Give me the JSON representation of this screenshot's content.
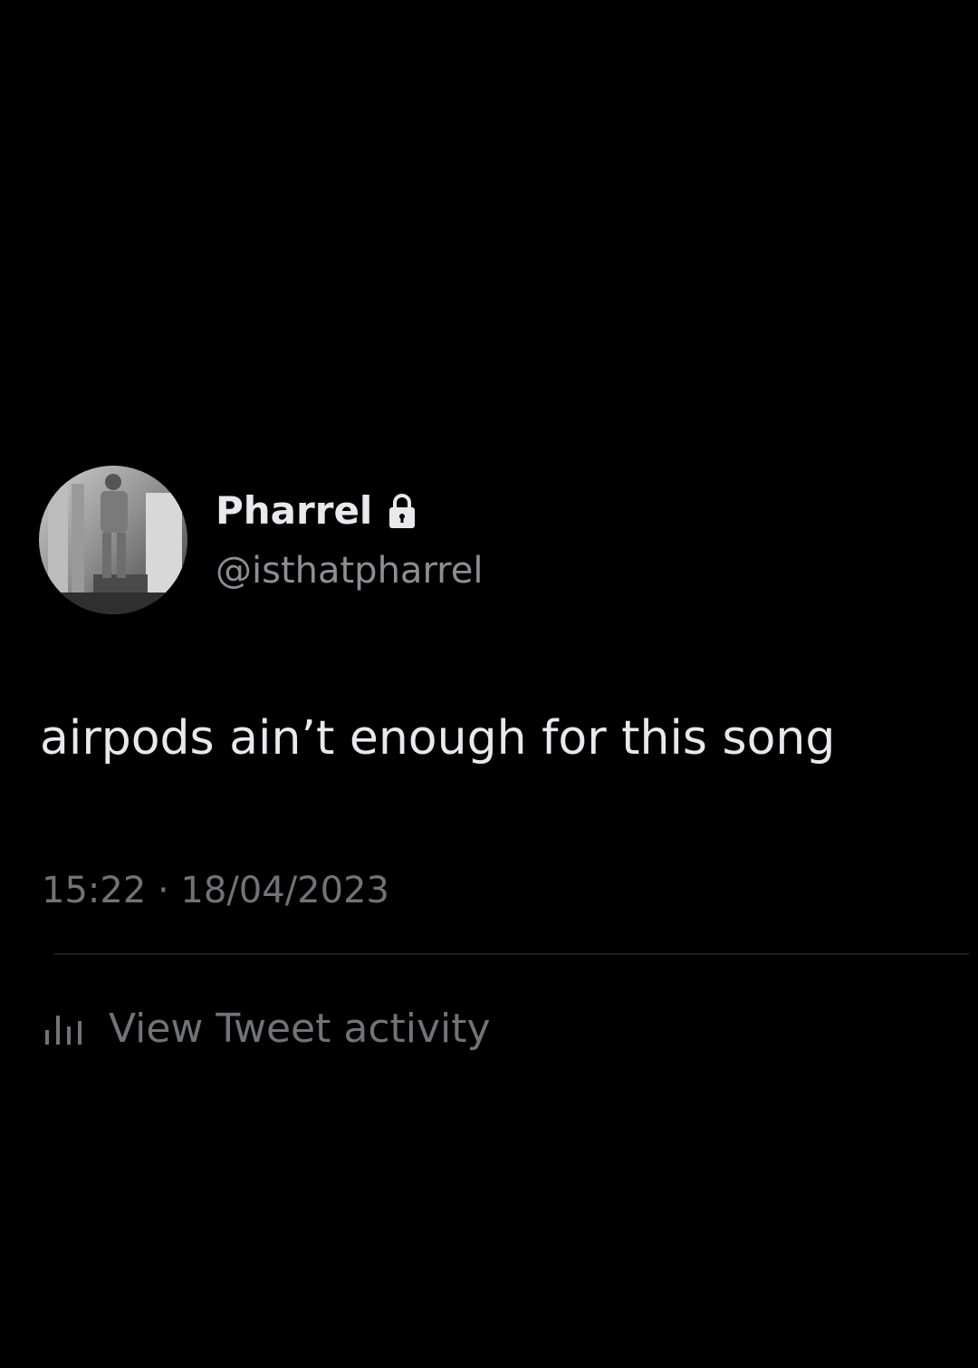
{
  "tweet": {
    "author": {
      "display_name": "Pharrel",
      "handle": "@isthatpharrel",
      "avatar_icon": "profile-photo",
      "badge_icon": "lock-icon"
    },
    "text": "airpods ain’t enough for this song",
    "timestamp": "15:22 · 18/04/2023",
    "activity": {
      "icon": "bar-chart-icon",
      "label": "View Tweet activity"
    }
  },
  "colors": {
    "background": "#000000",
    "primary_text": "#e7e9ea",
    "secondary_text": "#8b8f93",
    "muted_text": "#707478",
    "divider": "#1c1e20"
  }
}
